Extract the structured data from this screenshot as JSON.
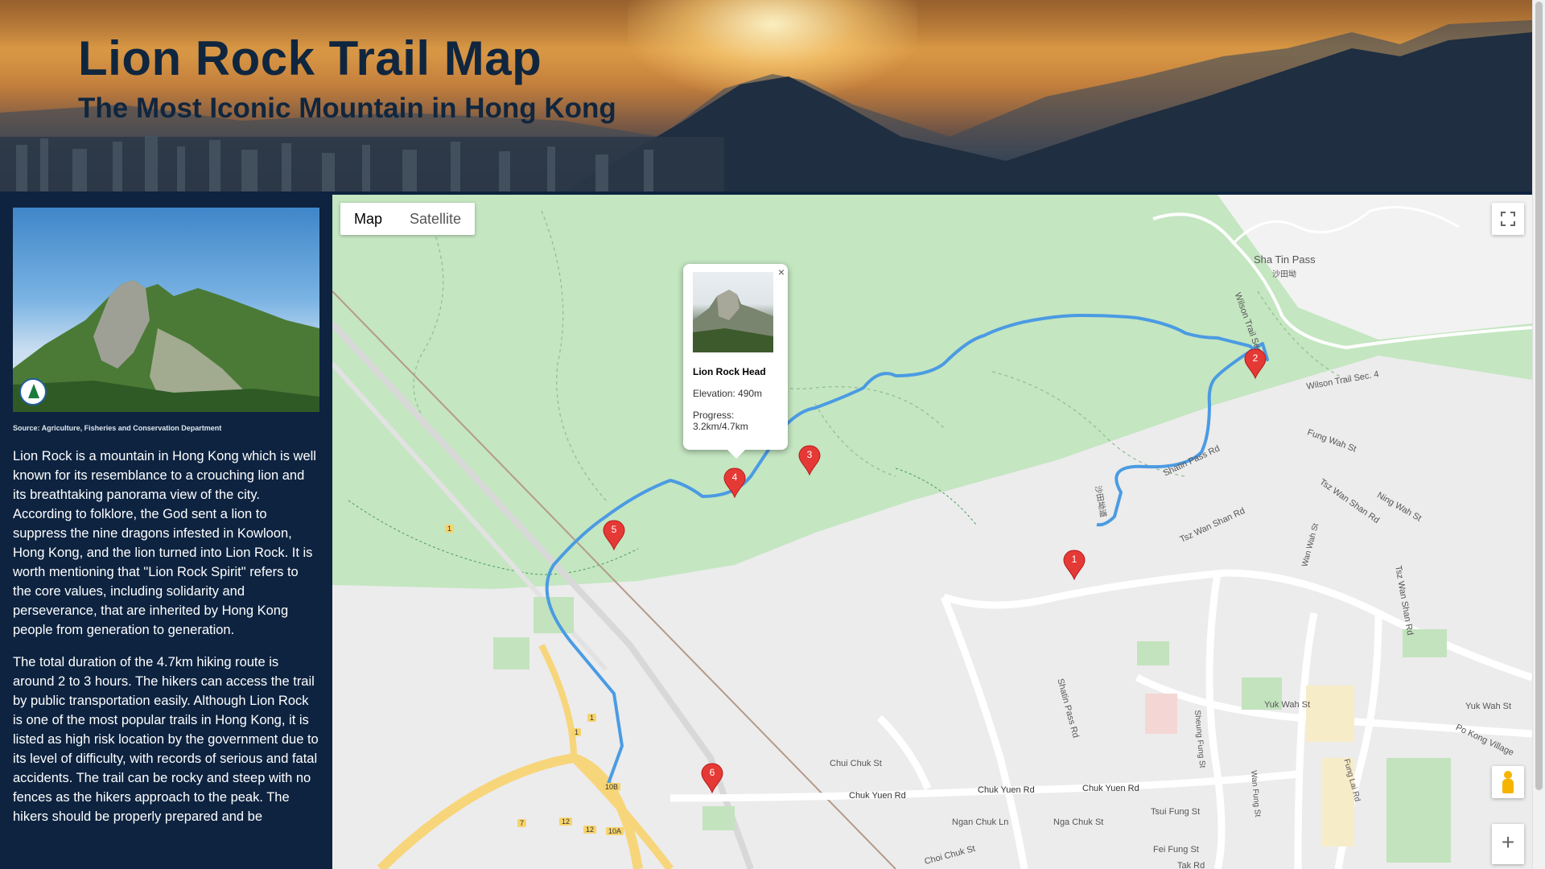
{
  "header": {
    "title": "Lion Rock Trail Map",
    "subtitle": "The Most Iconic Mountain in Hong Kong"
  },
  "sidebar": {
    "photo_credit": "Source: Agriculture, Fisheries and Conservation Department",
    "paragraphs": [
      "Lion Rock is a mountain in Hong Kong which is well known for its resemblance to a crouching lion and its breathtaking panorama view of the city. According to folklore, the God sent a lion to suppress the nine dragons infested in Kowloon, Hong Kong, and the lion turned into Lion Rock. It is worth mentioning that \"Lion Rock Spirit\" refers to the core values, including solidarity and perseverance, that are inherited by Hong Kong people from generation to generation.",
      "The total duration of the 4.7km hiking route is around 2 to 3 hours. The hikers can access the trail by public transportation easily. Although Lion Rock is one of the most popular trails in Hong Kong, it is listed as high risk location by the government due to its level of difficulty, with records of serious and fatal accidents. The trail can be rocky and steep with no fences as the hikers approach to the peak. The hikers should be properly prepared and be"
    ]
  },
  "map": {
    "type_controls": [
      {
        "label": "Map",
        "active": true
      },
      {
        "label": "Satellite",
        "active": false
      }
    ],
    "fullscreen_icon": "fullscreen-icon",
    "zoom_in_label": "+",
    "markers": [
      "1",
      "2",
      "3",
      "4",
      "5",
      "6"
    ],
    "info_window": {
      "close_label": "×",
      "name": "Lion Rock Head",
      "elevation": "Elevation: 490m",
      "progress": "Progress: 3.2km/4.7km"
    },
    "labels": {
      "sha_tin_pass": "Sha Tin Pass",
      "sha_tin_pass_zh": "沙田坳",
      "wilson_trail_5": "Wilson Trail Sec. 5",
      "wilson_trail_4": "Wilson Trail Sec. 4",
      "shatin_pass_rd": "Shatin Pass Rd",
      "shatin_pass_rd_2": "Shatin Pass Rd",
      "fung_wah_st": "Fung Wah St",
      "tsz_wan_shan_rd": "Tsz Wan Shan Rd",
      "tsz_wan_shan_rd_2": "Tsz Wan Shan Rd",
      "tsz_wan_shan_rd_3": "Tsz Wan Shan Rd",
      "wan_wah_st": "Wan Wah St",
      "ning_wah_st": "Ning Wah St",
      "yuk_wah_st": "Yuk Wah St",
      "yuk_wah_st_2": "Yuk Wah St",
      "po_kong_village": "Po Kong Village",
      "fung_lai_rd": "Fung Lai Rd",
      "sheung_fung_st": "Sheung Fung St",
      "wan_fung_st": "Wan Fung St",
      "tsui_fung_st": "Tsui Fung St",
      "fei_fung_st": "Fei Fung St",
      "chui_chuk_st": "Chui Chuk St",
      "chuk_yuen_rd_1": "Chuk Yuen Rd",
      "chuk_yuen_rd_2": "Chuk Yuen Rd",
      "chuk_yuen_rd_3": "Chuk Yuen Rd",
      "ngan_chuk_ln": "Ngan Chuk Ln",
      "nga_chuk_st": "Nga Chuk St",
      "choi_chuk_st": "Choi Chuk St",
      "tak_rd": "Tak Rd",
      "route_1a": "1",
      "route_1b": "1",
      "route_1c": "1",
      "route_10b": "10B",
      "route_10a": "10A",
      "route_7": "7",
      "route_12a": "12",
      "route_12b": "12",
      "shatin_pass_zh": "沙田坳道"
    }
  }
}
